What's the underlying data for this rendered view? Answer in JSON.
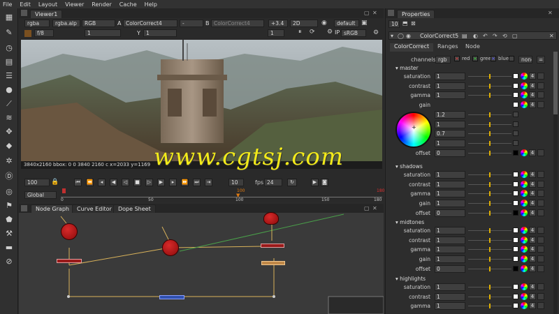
{
  "menu": [
    "File",
    "Edit",
    "Layout",
    "Viewer",
    "Render",
    "Cache",
    "Help"
  ],
  "viewer": {
    "tab": "Viewer1",
    "channels": "rgba",
    "alpha": "rgba.alp",
    "colorspace": "RGB",
    "a_label": "A",
    "a_input": "ColorCorrect4",
    "dash": "-",
    "b_label": "B",
    "b_input": "ColorCorrect4",
    "gain": "+3.4",
    "mode": "2D",
    "lut": "default",
    "fstop": "f/8",
    "one": "1",
    "y_label": "Y",
    "y_value": "1",
    "frame_field": "1",
    "ip": "IP",
    "srgb": "sRGB",
    "info": "3840x2160 bbox: 0 0 3840 2160 c x=2033 y=1169",
    "frame": "100",
    "step": "10",
    "fps_label": "fps",
    "fps": "24",
    "range_mode": "Global",
    "timeline_ticks": [
      "0",
      "50",
      "100",
      "150",
      "180"
    ],
    "current_frame_marker": "100",
    "end_marker": "180"
  },
  "watermark": "www.cgtsj.com",
  "nodegraph": {
    "tabs": [
      "Node Graph",
      "Curve Editor",
      "Dope Sheet"
    ]
  },
  "properties": {
    "tab": "Properties",
    "count": "10",
    "node_name": "ColorCorrect5",
    "subtabs": [
      "ColorCorrect",
      "Ranges",
      "Node"
    ],
    "channels_label": "channels",
    "channels_value": "rgb",
    "ch_red": "red",
    "ch_green": "green",
    "ch_blue": "blue",
    "ch_none": "none",
    "ch_eq": "=",
    "sections": {
      "master": {
        "title": "master",
        "rows": [
          {
            "label": "saturation",
            "value": "1"
          },
          {
            "label": "contrast",
            "value": "1"
          },
          {
            "label": "gamma",
            "value": "1"
          },
          {
            "label": "gain",
            "value": ""
          },
          {
            "label": "",
            "value": "1.2"
          },
          {
            "label": "",
            "value": "1"
          },
          {
            "label": "",
            "value": "0.7"
          },
          {
            "label": "",
            "value": "1"
          },
          {
            "label": "offset",
            "value": "0"
          }
        ]
      },
      "shadows": {
        "title": "shadows",
        "rows": [
          {
            "label": "saturation",
            "value": "1"
          },
          {
            "label": "contrast",
            "value": "1"
          },
          {
            "label": "gamma",
            "value": "1"
          },
          {
            "label": "gain",
            "value": "1"
          },
          {
            "label": "offset",
            "value": "0"
          }
        ]
      },
      "midtones": {
        "title": "midtones",
        "rows": [
          {
            "label": "saturation",
            "value": "1"
          },
          {
            "label": "contrast",
            "value": "1"
          },
          {
            "label": "gamma",
            "value": "1"
          },
          {
            "label": "gain",
            "value": "1"
          },
          {
            "label": "offset",
            "value": "0"
          }
        ]
      },
      "highlights": {
        "title": "highlights",
        "rows": [
          {
            "label": "saturation",
            "value": "1"
          },
          {
            "label": "contrast",
            "value": "1"
          },
          {
            "label": "gamma",
            "value": "1"
          }
        ]
      }
    },
    "four": "4"
  },
  "colors": {
    "accent": "#e0b000",
    "node_red": "#c01a1a",
    "panel_bg": "#2b2b2b"
  }
}
